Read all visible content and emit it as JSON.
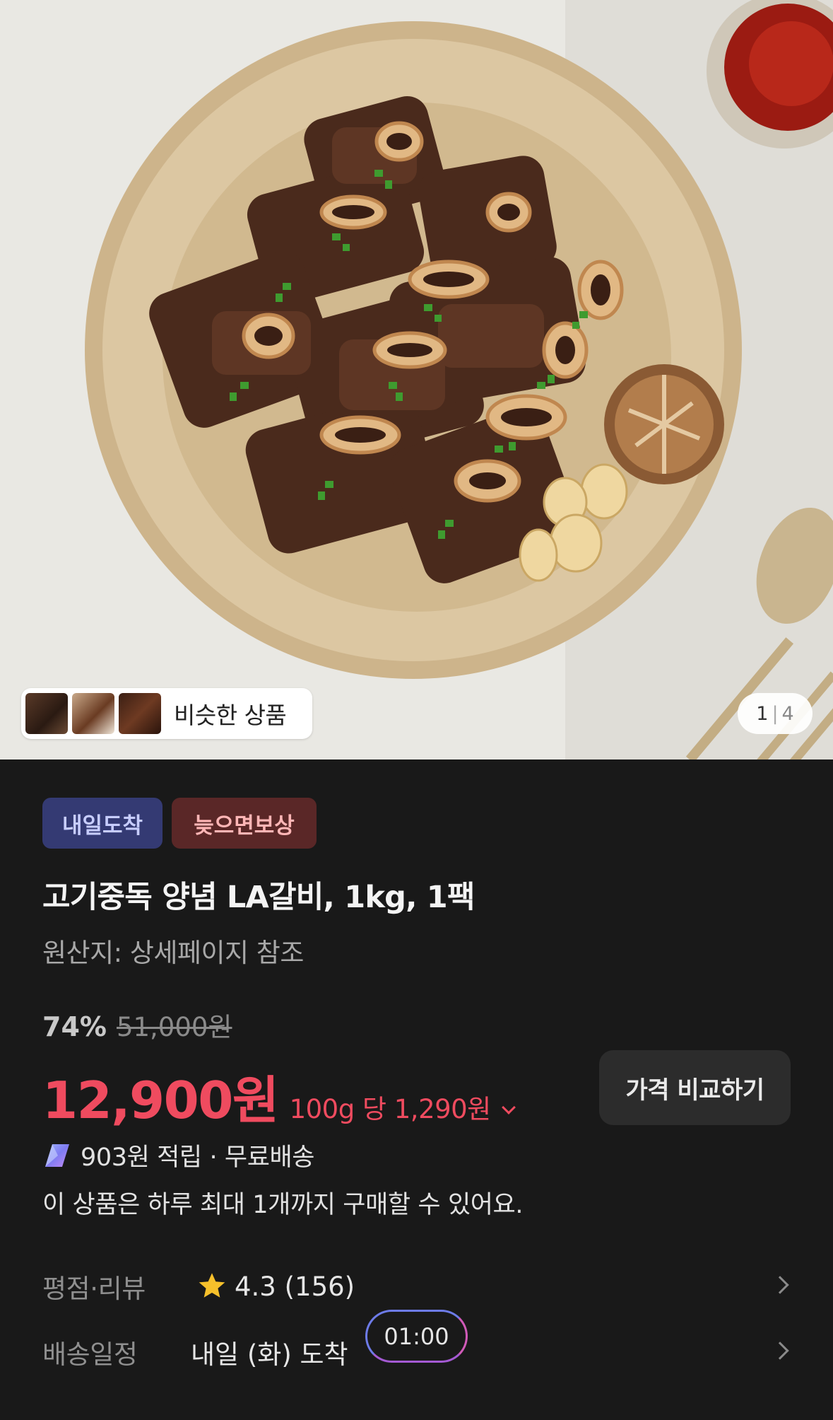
{
  "hero": {
    "similar_label": "비슷한 상품",
    "page_current": "1",
    "page_separator": "|",
    "page_total": "4"
  },
  "badges": {
    "arrival": "내일도착",
    "compensation": "늦으면보상"
  },
  "product": {
    "title": "고기중독 양념 LA갈비, 1kg, 1팩",
    "origin": "원산지: 상세페이지 참조",
    "discount": "74%",
    "original_price": "51,000원",
    "price": "12,900원",
    "unit_price": "100g 당 1,290원",
    "compare_button": "가격 비교하기",
    "points_shipping": "903원 적립 · 무료배송",
    "purchase_limit": "이 상품은 하루 최대 1개까지 구매할 수 있어요."
  },
  "rows": {
    "rating_key": "평점·리뷰",
    "rating_value": "4.3 (156)",
    "delivery_key": "배송일정",
    "delivery_value": "내일 (화) 도착",
    "timer": "01:00"
  },
  "colors": {
    "price": "#ef4b5f",
    "arrival_badge_bg": "#343a73",
    "compensation_badge_bg": "#5a2727",
    "background": "#191919"
  },
  "icons": {
    "points": "gem-icon",
    "rating": "star-icon",
    "row_arrow": "chevron-right-icon",
    "unit_price_toggle": "chevron-down-icon"
  }
}
